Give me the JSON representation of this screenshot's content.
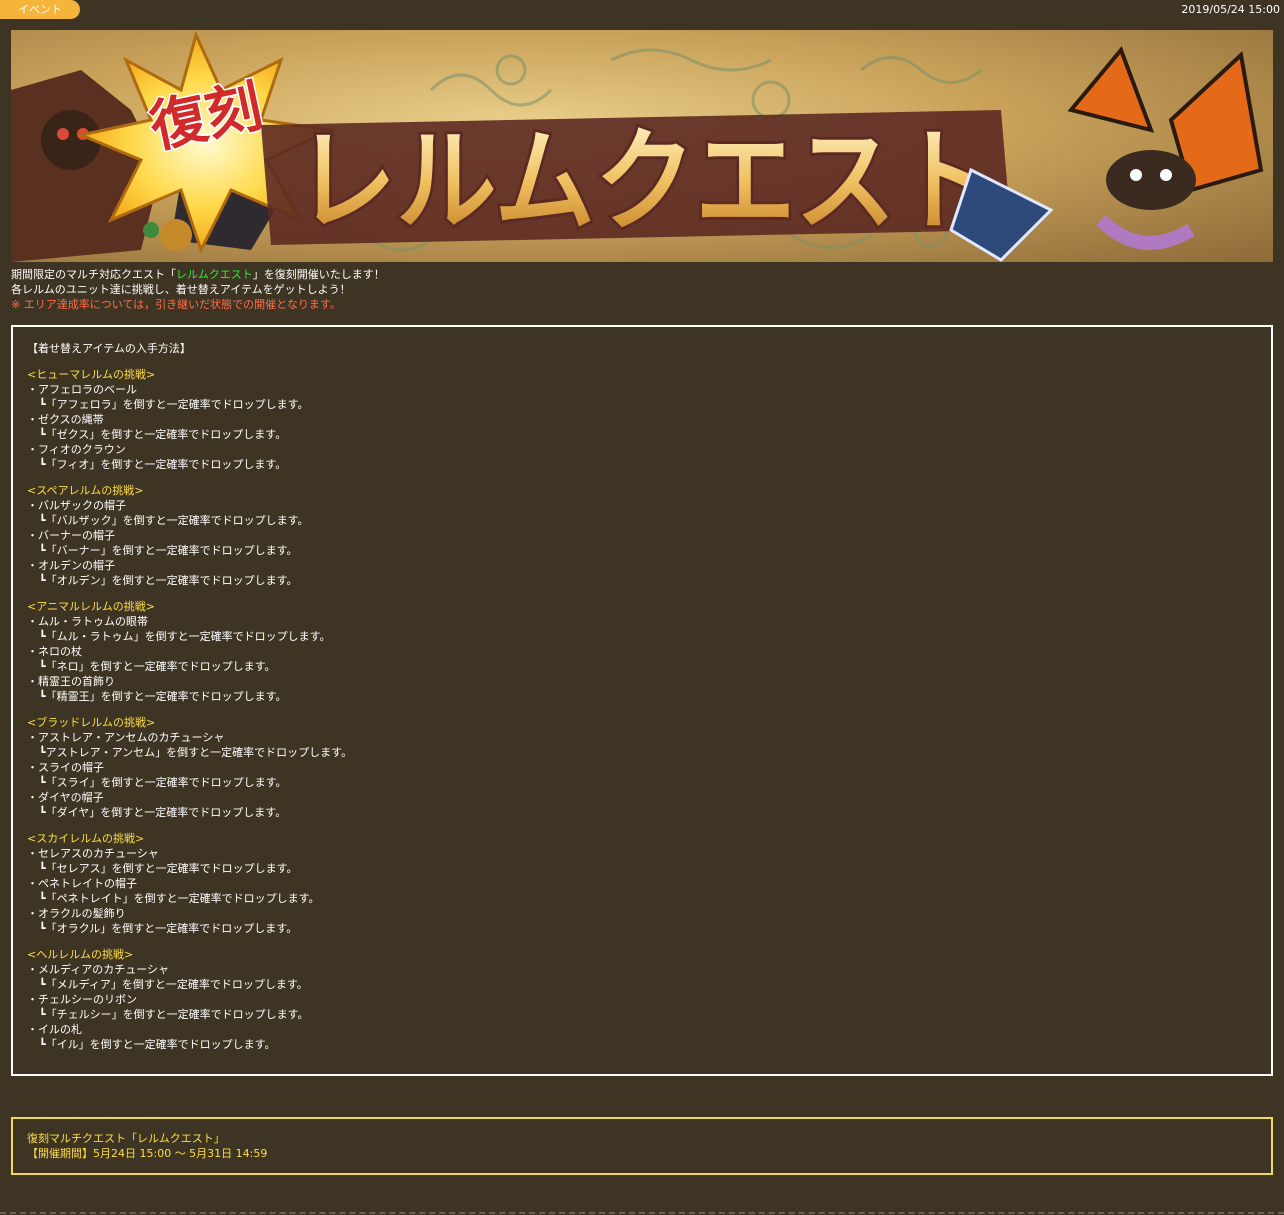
{
  "header": {
    "category_label": "イベント",
    "date": "2019/05/24 15:00"
  },
  "banner": {
    "badge_text": "復刻",
    "title_text": "レルムクエスト"
  },
  "intro": {
    "line1_pre": "期間限定のマルチ対応クエスト「",
    "line1_highlight": "レルムクエスト",
    "line1_post": "」を復刻開催いたします！",
    "line2": "各レルムのユニット達に挑戦し、着せ替えアイテムをゲットしよう！",
    "note": "※ エリア達成率については，引き継いだ状態での開催となります。"
  },
  "colors": {
    "background": "#3d3424",
    "tag": "#f4b53a",
    "highlight_green": "#33ee33",
    "note_red": "#ff6e4a",
    "section_yellow": "#ffdd44"
  },
  "items_box": {
    "heading": "【着せ替えアイテムの入手方法】",
    "sections": [
      {
        "title": "<ヒューマレルムの挑戦>",
        "entries": [
          {
            "item": "・アフェロラのベール",
            "drop": "┗「アフェロラ」を倒すと一定確率でドロップします。"
          },
          {
            "item": "・ゼクスの縄帯",
            "drop": "┗「ゼクス」を倒すと一定確率でドロップします。"
          },
          {
            "item": "・フィオのクラウン",
            "drop": "┗「フィオ」を倒すと一定確率でドロップします。"
          }
        ]
      },
      {
        "title": "<スペアレルムの挑戦>",
        "entries": [
          {
            "item": "・バルザックの帽子",
            "drop": "┗「バルザック」を倒すと一定確率でドロップします。"
          },
          {
            "item": "・バーナーの帽子",
            "drop": "┗「バーナー」を倒すと一定確率でドロップします。"
          },
          {
            "item": "・オルデンの帽子",
            "drop": "┗「オルデン」を倒すと一定確率でドロップします。"
          }
        ]
      },
      {
        "title": "<アニマルレルムの挑戦>",
        "entries": [
          {
            "item": "・ムル・ラトゥムの眼帯",
            "drop": "┗「ムル・ラトゥム」を倒すと一定確率でドロップします。"
          },
          {
            "item": "・ネロの杖",
            "drop": "┗「ネロ」を倒すと一定確率でドロップします。"
          },
          {
            "item": "・精霊王の首飾り",
            "drop": "┗「精霊王」を倒すと一定確率でドロップします。"
          }
        ]
      },
      {
        "title": "<ブラッドレルムの挑戦>",
        "entries": [
          {
            "item": "・アストレア・アンセムのカチューシャ",
            "drop": "┗アストレア・アンセム」を倒すと一定確率でドロップします。"
          },
          {
            "item": "・スライの帽子",
            "drop": "┗「スライ」を倒すと一定確率でドロップします。"
          },
          {
            "item": "・ダイヤの帽子",
            "drop": "┗「ダイヤ」を倒すと一定確率でドロップします。"
          }
        ]
      },
      {
        "title": "<スカイレルムの挑戦>",
        "entries": [
          {
            "item": "・セレアスのカチューシャ",
            "drop": "┗「セレアス」を倒すと一定確率でドロップします。"
          },
          {
            "item": "・ペネトレイトの帽子",
            "drop": "┗「ペネトレイト」を倒すと一定確率でドロップします。"
          },
          {
            "item": "・オラクルの髪飾り",
            "drop": "┗「オラクル」を倒すと一定確率でドロップします。"
          }
        ]
      },
      {
        "title": "<ヘルレルムの挑戦>",
        "entries": [
          {
            "item": "・メルディアのカチューシャ",
            "drop": "┗「メルディア」を倒すと一定確率でドロップします。"
          },
          {
            "item": "・チェルシーのリボン",
            "drop": "┗「チェルシー」を倒すと一定確率でドロップします。"
          },
          {
            "item": "・イルの札",
            "drop": "┗「イル」を倒すと一定確率でドロップします。"
          }
        ]
      }
    ]
  },
  "period_box": {
    "title": "復刻マルチクエスト「レルムクエスト」",
    "period": "【開催期間】5月24日 15:00 ～ 5月31日 14:59"
  }
}
